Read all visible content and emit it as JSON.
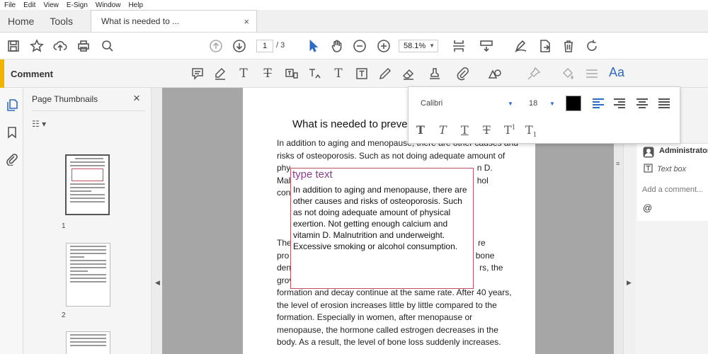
{
  "menubar": [
    "File",
    "Edit",
    "View",
    "E-Sign",
    "Window",
    "Help"
  ],
  "tabs": {
    "home": "Home",
    "tools": "Tools",
    "document": "What is needed to ...",
    "close": "×"
  },
  "toolbar": {
    "page_current": "1",
    "page_total": "/ 3",
    "zoom": "58.1%"
  },
  "comment_bar": {
    "label": "Comment",
    "text_props_icon": "Aa"
  },
  "thumbnails": {
    "title": "Page Thumbnails",
    "close": "×",
    "options": "☷ ▾",
    "pages": [
      "1",
      "2"
    ]
  },
  "document": {
    "title": "What is needed to preven",
    "para1": [
      "In addition to aging and menopause, there are other causes and",
      "risks of osteoporosis. Such as not doing adequate amount of",
      "phy                                                                               n D.",
      "Mal                                                                               hol",
      "cons"
    ],
    "para2": [
      "The                                                                               re",
      "pro                                                                               bone",
      "dens                                                                              rs, the",
      "grov",
      "formation and decay continue at the same rate. After 40 years,",
      "the level of erosion increases little by little compared to the",
      "formation. Especially in women, after menopause or",
      "menopause, the hormone called estrogen decreases in the",
      "body. As a result, the level of bone loss suddenly increases."
    ]
  },
  "textbox": {
    "title": "type text",
    "body": "In addition to aging and menopause, there are other causes and risks of osteoporosis. Such as not doing adequate amount of physical exertion. Not getting enough calcium and vitamin D. Malnutrition and underweight. Excessive smoking or alcohol consumption."
  },
  "font_popup": {
    "font": "Calibri",
    "size": "18",
    "color": "#000000"
  },
  "comment_panel": {
    "author": "Administrator",
    "type": "Text box",
    "add_comment": "Add a comment...",
    "mention": "@"
  },
  "colors": {
    "accent": "#f0b400",
    "blue": "#2d6cc4",
    "annotation_border": "#c05060",
    "annotation_title": "#8a3d8a"
  }
}
